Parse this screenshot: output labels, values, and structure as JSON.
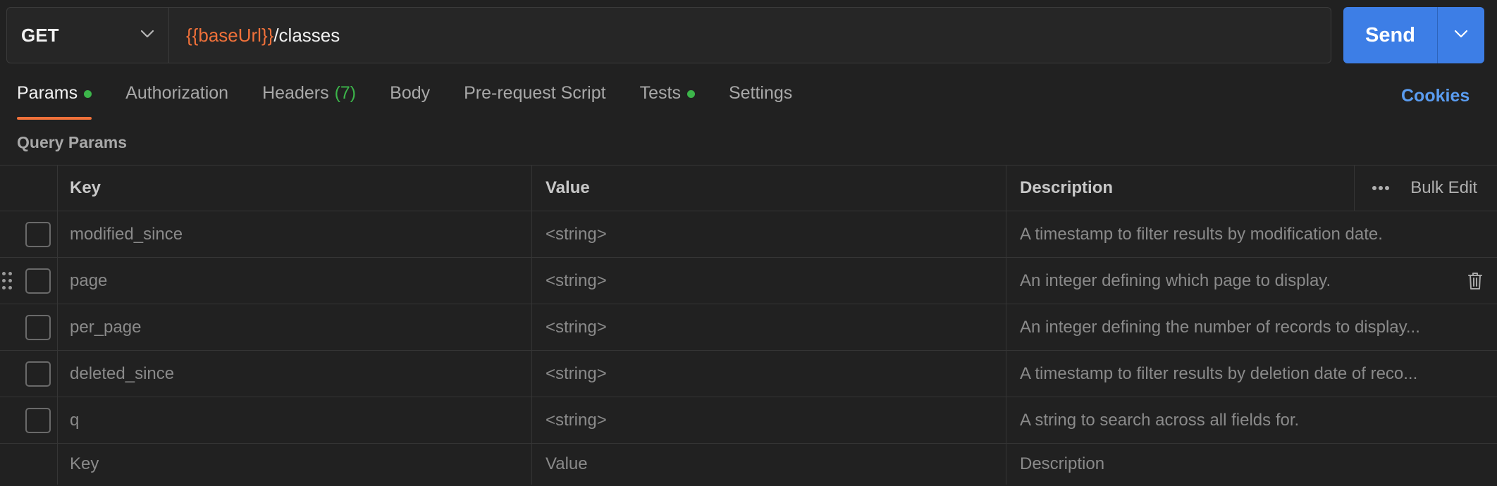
{
  "request": {
    "method": "GET",
    "url_variable": "{{baseUrl}}",
    "url_path": "/classes",
    "send_label": "Send"
  },
  "tabs": [
    {
      "label": "Params",
      "active": true,
      "dot": true
    },
    {
      "label": "Authorization"
    },
    {
      "label": "Headers",
      "count": "(7)"
    },
    {
      "label": "Body"
    },
    {
      "label": "Pre-request Script"
    },
    {
      "label": "Tests",
      "dot": true
    },
    {
      "label": "Settings"
    }
  ],
  "cookies_label": "Cookies",
  "section_title": "Query Params",
  "table": {
    "headers": {
      "key": "Key",
      "value": "Value",
      "description": "Description",
      "bulk_edit": "Bulk Edit"
    },
    "rows": [
      {
        "key": "modified_since",
        "value": "<string>",
        "description": "A timestamp to filter results by modification date."
      },
      {
        "key": "page",
        "value": "<string>",
        "description": "An integer defining which page to display."
      },
      {
        "key": "per_page",
        "value": "<string>",
        "description": "An integer defining the number of records to display..."
      },
      {
        "key": "deleted_since",
        "value": "<string>",
        "description": "A timestamp to filter results by deletion date of reco..."
      },
      {
        "key": "q",
        "value": "<string>",
        "description": "A string to search across all fields for."
      }
    ],
    "placeholders": {
      "key": "Key",
      "value": "Value",
      "description": "Description"
    }
  },
  "colors": {
    "accent_orange": "#f0713a",
    "send_blue": "#3d7ee6",
    "status_green": "#3cb54a",
    "link_blue": "#5a9cf0"
  },
  "icons": [
    "chevron-down-icon",
    "more-horizontal-icon",
    "drag-handle-icon",
    "trash-icon"
  ]
}
